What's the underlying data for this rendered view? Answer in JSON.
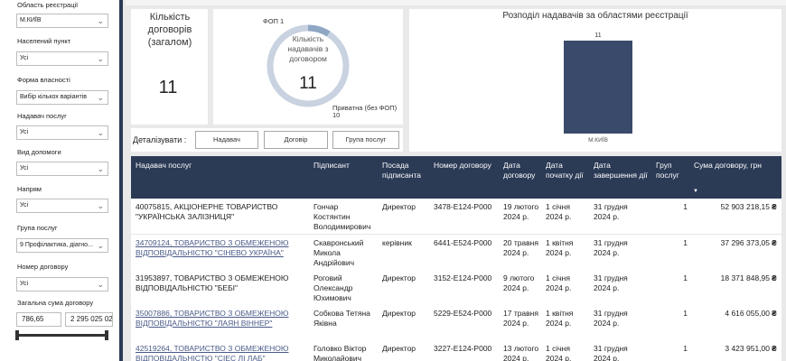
{
  "filters": [
    {
      "label": "Область реєстрації",
      "value": "М.КИЇВ",
      "label_top": 1,
      "select_top": 15
    },
    {
      "label": "Населений пункт",
      "value": "Усі",
      "label_top": 41,
      "select_top": 57
    },
    {
      "label": "Форма власності",
      "value": "Вибір кількох варіантів",
      "label_top": 84,
      "select_top": 100
    },
    {
      "label": "Надавач послуг",
      "value": "Усі",
      "label_top": 124,
      "select_top": 139
    },
    {
      "label": "Вид допомоги",
      "value": "Усі",
      "label_top": 164,
      "select_top": 179
    },
    {
      "label": "Напрям",
      "value": "Усі",
      "label_top": 205,
      "select_top": 220
    },
    {
      "label": "Група послуг",
      "value": "9 Профілактика, діагно...",
      "label_top": 248,
      "select_top": 264
    },
    {
      "label": "Номер договору",
      "value": "Усі",
      "label_top": 291,
      "select_top": 307
    },
    {
      "label": "Загальна сума договору",
      "value": "",
      "label_top": 331,
      "select_top": 0
    }
  ],
  "range": {
    "min": "786,65",
    "max": "2 295 025 02"
  },
  "kpi": {
    "title": "Кількість договорів (загалом)",
    "value": "11"
  },
  "donut": {
    "center_label": "Кількість надавачів з договором",
    "value": "11",
    "slices": [
      {
        "name": "ФОП",
        "value": 1,
        "label": "ФОП 1",
        "color": "#8fa6c4"
      },
      {
        "name": "Приватна (без ФОП)",
        "value": 10,
        "label": "Приватна (без ФОП)",
        "value_label": "10",
        "color": "#c8d2e0"
      }
    ]
  },
  "bar_chart": {
    "title": "Розподіл надавачів за областями реєстрації"
  },
  "chart_data": {
    "type": "bar",
    "title": "Розподіл надавачів за областями реєстрації",
    "categories": [
      "М.КИЇВ"
    ],
    "values": [
      11
    ],
    "ylim": [
      0,
      11
    ]
  },
  "detail": {
    "label": "Деталізувати :",
    "buttons": [
      "Надавач",
      "Договір",
      "Група послуг"
    ]
  },
  "table": {
    "headers": [
      "Надавач послуг",
      "Підписант",
      "Посада підписанта",
      "Номер договору",
      "Дата договору",
      "Дата початку дії",
      "Дата завершення дії",
      "Груп послуг",
      "Сума договору, грн"
    ],
    "rows": [
      {
        "provider": "40075815, АКЦІОНЕРНЕ ТОВАРИСТВО \"УКРАЇНСЬКА ЗАЛІЗНИЦЯ\"",
        "link": false,
        "signer": "Гончар Костянтин Володимирович",
        "position": "Директор",
        "number": "3478-E124-P000",
        "date": "19 лютого 2024 р.",
        "start": "1 січня 2024 р.",
        "end": "31 грудня 2024 р.",
        "groups": "1",
        "sum": "52 903 218,15",
        "currency": "₴"
      },
      {
        "provider": "34709124, ТОВАРИСТВО З ОБМЕЖЕНОЮ ВІДПОВІДАЛЬНІСТЮ \"СІНЕВО УКРАЇНА\"",
        "link": true,
        "signer": "Скавронський Микола Андрійович",
        "position": "керівник",
        "number": "6441-E524-P000",
        "date": "20 травня 2024 р.",
        "start": "1 квітня 2024 р.",
        "end": "31 грудня 2024 р.",
        "groups": "1",
        "sum": "37 296 373,05",
        "currency": "₴"
      },
      {
        "provider": "31953897, ТОВАРИСТВО З ОБМЕЖЕНОЮ ВІДПОВІДАЛЬНІСТЮ \"БЕБІ\"",
        "link": false,
        "signer": "Роговий Олександр Юхимович",
        "position": "Директор",
        "number": "3152-E124-P000",
        "date": "9 лютого 2024 р.",
        "start": "1 січня 2024 р.",
        "end": "31 грудня 2024 р.",
        "groups": "1",
        "sum": "18 371 848,95",
        "currency": "₴"
      },
      {
        "provider": "35007886, ТОВАРИСТВО З ОБМЕЖЕНОЮ ВІДПОВІДАЛЬНІСТЮ \"ЛАЯН ВІННЕР\"",
        "link": true,
        "signer": "Собкова Тетяна Яківна",
        "position": "Директор",
        "number": "5229-E524-P000",
        "date": "17 травня 2024 р.",
        "start": "1 квітня 2024 р.",
        "end": "31 грудня 2024 р.",
        "groups": "1",
        "sum": "4 616 055,00",
        "currency": "₴"
      },
      {
        "provider": "42519264, ТОВАРИСТВО З ОБМЕЖЕНОЮ ВІДПОВІДАЛЬНІСТЮ \"СІЕС ЛІ ЛАБ\"",
        "link": true,
        "signer": "Головко Віктор Миколайович",
        "position": "Директор",
        "number": "3227-E124-P000",
        "date": "13 лютого 2024 р.",
        "start": "1 січня 2024 р.",
        "end": "31 грудня 2024 р.",
        "groups": "1",
        "sum": "3 423 951,00",
        "currency": "₴"
      }
    ]
  },
  "colors": {
    "navy": "#2b3a55",
    "bar": "#3a4a6b",
    "link": "#4a5a88"
  }
}
